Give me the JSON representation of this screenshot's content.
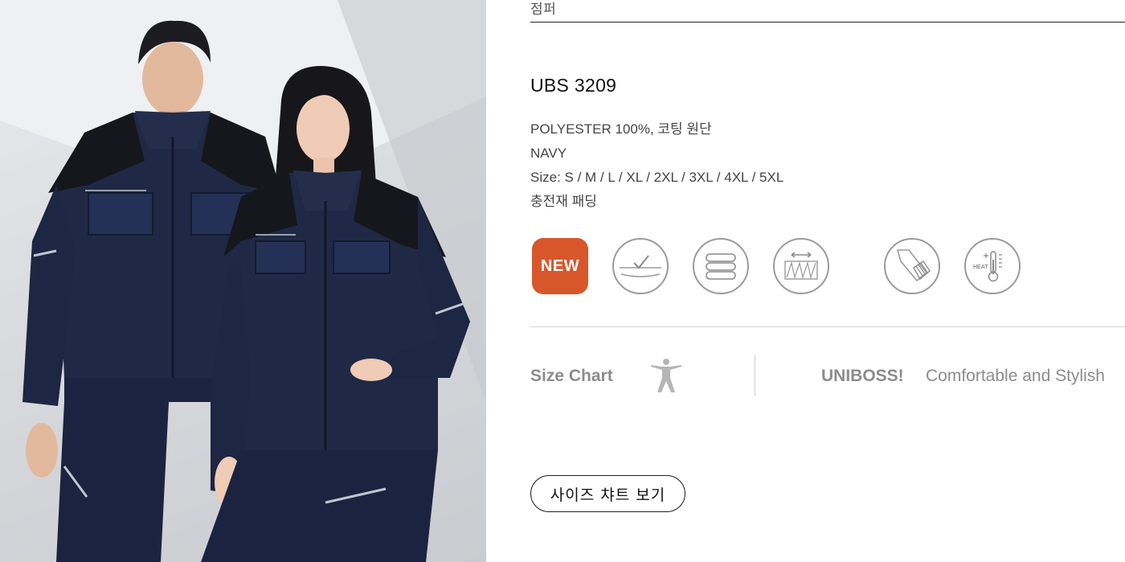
{
  "product": {
    "category": "점퍼",
    "name": "UBS 3209",
    "specs": [
      "POLYESTER 100%, 코팅 원단",
      "NAVY",
      "Size: S / M / L / XL / 2XL / 3XL / 4XL / 5XL",
      "충전재 패딩"
    ]
  },
  "features": {
    "new_badge": "NEW",
    "heat_label": "HEAT",
    "icons": [
      "new-badge",
      "waterproof-check-icon",
      "padding-layers-icon",
      "stretch-fabric-icon",
      "cuff-rib-icon",
      "heat-thermometer-icon"
    ]
  },
  "size_section": {
    "label": "Size Chart",
    "brand": "UNIBOSS!",
    "slogan": "Comfortable and Stylish",
    "button_label": "사이즈 챠트 보기"
  },
  "colors": {
    "new_badge": "#d8572a",
    "jacket_navy": "#1f2945",
    "icon_gray": "#9a9a9a"
  }
}
